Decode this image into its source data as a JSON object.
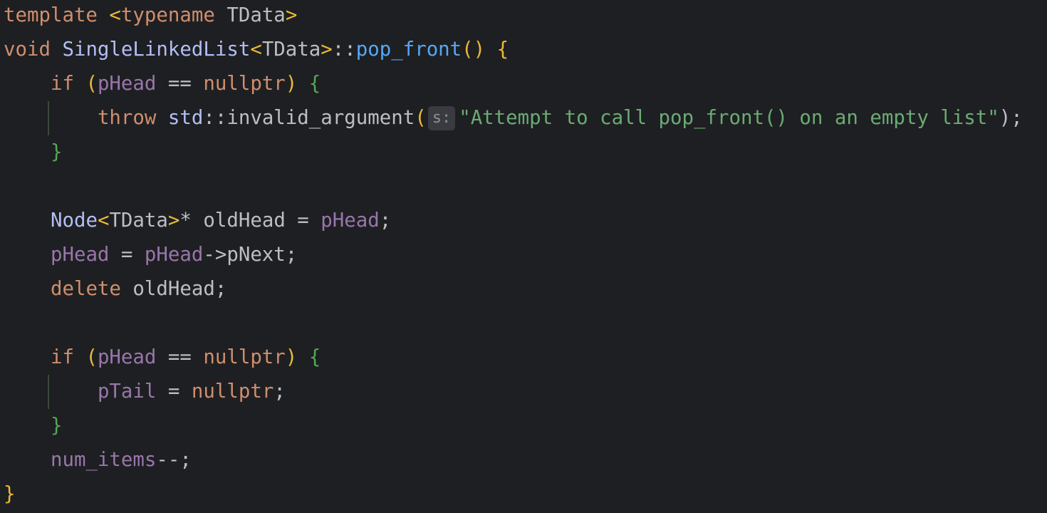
{
  "colors": {
    "background": "#1e1f22",
    "keyword": "#cf8e6d",
    "type": "#bcbec4",
    "class": "#b3bef5",
    "function": "#56a8f5",
    "member": "#c77dbb",
    "field": "#9876aa",
    "string": "#6aab73",
    "brace1": "#e8ba36",
    "brace2": "#54a857",
    "default": "#bcbec4",
    "hint_bg": "#393b40",
    "hint_fg": "#8c8f95"
  },
  "code": {
    "line1": {
      "kw_template": "template",
      "angle_open": " <",
      "kw_typename": "typename",
      "tdata": " TData",
      "angle_close": ">"
    },
    "line2": {
      "kw_void": "void",
      "class_name": " SingleLinkedList",
      "angle_open": "<",
      "tdata": "TData",
      "angle_close": ">",
      "scope": "::",
      "func_name": "pop_front",
      "parens": "()",
      "brace_open": " {"
    },
    "line3": {
      "kw_if": "if",
      "paren_open": " (",
      "phead": "pHead",
      "op": " == ",
      "nullptr": "nullptr",
      "paren_close": ")",
      "brace_open": " {"
    },
    "line4": {
      "kw_throw": "throw",
      "ns": " std",
      "scope": "::",
      "func": "invalid_argument",
      "paren_open": "(",
      "hint": "s:",
      "string": "\"Attempt to call pop_front() on an empty list\"",
      "tail": ");"
    },
    "line5": {
      "brace_close": "}"
    },
    "line7": {
      "node": "Node",
      "angle_open": "<",
      "tdata": "TData",
      "angle_close": ">",
      "rest": "* oldHead = ",
      "phead": "pHead",
      "semi": ";"
    },
    "line8": {
      "phead1": "pHead",
      "assign": " = ",
      "phead2": "pHead",
      "arrow_next": "->pNext;"
    },
    "line9": {
      "kw_delete": "delete",
      "rest": " oldHead;"
    },
    "line11": {
      "kw_if": "if",
      "paren_open": " (",
      "phead": "pHead",
      "op": " == ",
      "nullptr": "nullptr",
      "paren_close": ")",
      "brace_open": " {"
    },
    "line12": {
      "ptail": "pTail",
      "assign": " = ",
      "nullptr": "nullptr",
      "semi": ";"
    },
    "line13": {
      "brace_close": "}"
    },
    "line14": {
      "num_items": "num_items",
      "rest": "--;"
    },
    "line15": {
      "brace_close": "}"
    }
  }
}
